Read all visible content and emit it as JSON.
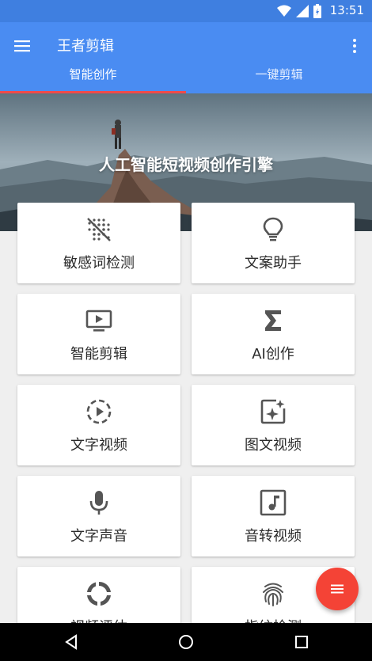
{
  "status": {
    "time": "13:51"
  },
  "appbar": {
    "title": "王者剪辑"
  },
  "tabs": [
    {
      "label": "智能创作"
    },
    {
      "label": "一键剪辑"
    }
  ],
  "hero": {
    "title": "人工智能短视频创作引擎"
  },
  "features": [
    {
      "label": "敏感词检测",
      "icon": "sparkle-off-icon"
    },
    {
      "label": "文案助手",
      "icon": "lightbulb-icon"
    },
    {
      "label": "智能剪辑",
      "icon": "tv-play-icon"
    },
    {
      "label": "AI创作",
      "icon": "sigma-icon"
    },
    {
      "label": "文字视频",
      "icon": "dashed-play-icon"
    },
    {
      "label": "图文视频",
      "icon": "sparkle-image-icon"
    },
    {
      "label": "文字声音",
      "icon": "microphone-icon"
    },
    {
      "label": "音转视频",
      "icon": "music-note-icon"
    },
    {
      "label": "视频评估",
      "icon": "loading-circle-icon"
    },
    {
      "label": "指纹检测",
      "icon": "fingerprint-icon"
    }
  ],
  "colors": {
    "primary": "#4a8cf2",
    "indicator": "#f04a4a",
    "fab": "#f44336",
    "icon": "#555555"
  }
}
